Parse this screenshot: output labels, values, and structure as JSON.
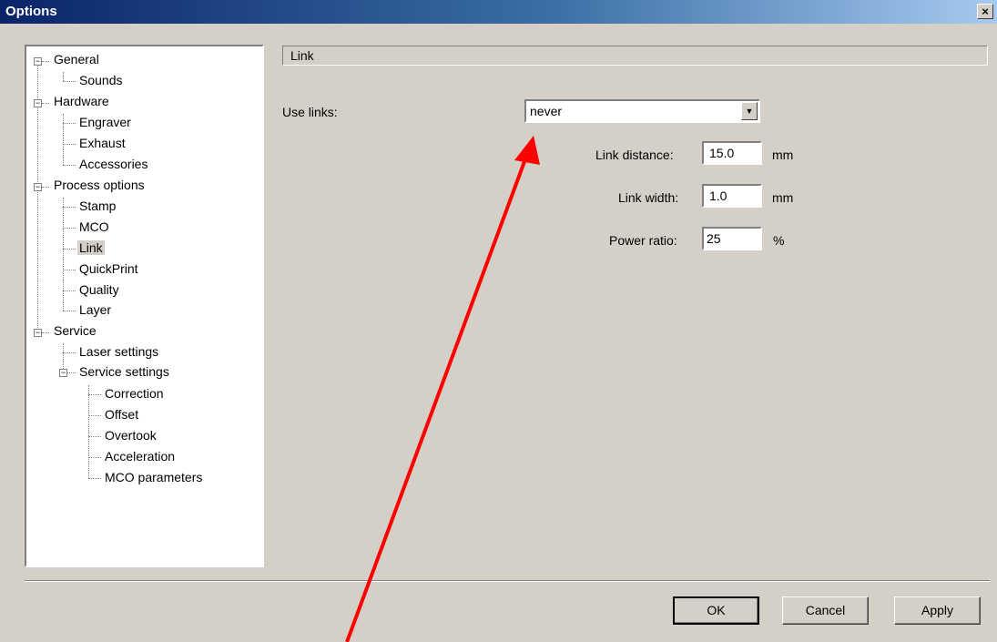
{
  "window": {
    "title": "Options",
    "close_label": "×"
  },
  "tree": {
    "items": [
      {
        "label": "General",
        "expanded": true
      },
      {
        "label": "Sounds"
      },
      {
        "label": "Hardware",
        "expanded": true
      },
      {
        "label": "Engraver"
      },
      {
        "label": "Exhaust"
      },
      {
        "label": "Accessories"
      },
      {
        "label": "Process options",
        "expanded": true
      },
      {
        "label": "Stamp"
      },
      {
        "label": "MCO"
      },
      {
        "label": "Link",
        "selected": true
      },
      {
        "label": "QuickPrint"
      },
      {
        "label": "Quality"
      },
      {
        "label": "Layer"
      },
      {
        "label": "Service",
        "expanded": true
      },
      {
        "label": "Laser settings"
      },
      {
        "label": "Service settings",
        "expanded": true
      },
      {
        "label": "Correction"
      },
      {
        "label": "Offset"
      },
      {
        "label": "Overtook"
      },
      {
        "label": "Acceleration"
      },
      {
        "label": "MCO parameters"
      }
    ],
    "collapse_glyph": "−"
  },
  "panel": {
    "header": "Link",
    "use_links_label": "Use links:",
    "use_links_value": "never",
    "dropdown_arrow": "▼",
    "link_distance_label": "Link distance:",
    "link_distance_value": "15.0",
    "link_distance_unit": "mm",
    "link_width_label": "Link width:",
    "link_width_value": "1.0",
    "link_width_unit": "mm",
    "power_ratio_label": "Power ratio:",
    "power_ratio_value": "25",
    "power_ratio_unit": "%"
  },
  "buttons": {
    "ok": "OK",
    "cancel": "Cancel",
    "apply": "Apply"
  },
  "annotation": {
    "arrow_color": "#ff0000"
  }
}
